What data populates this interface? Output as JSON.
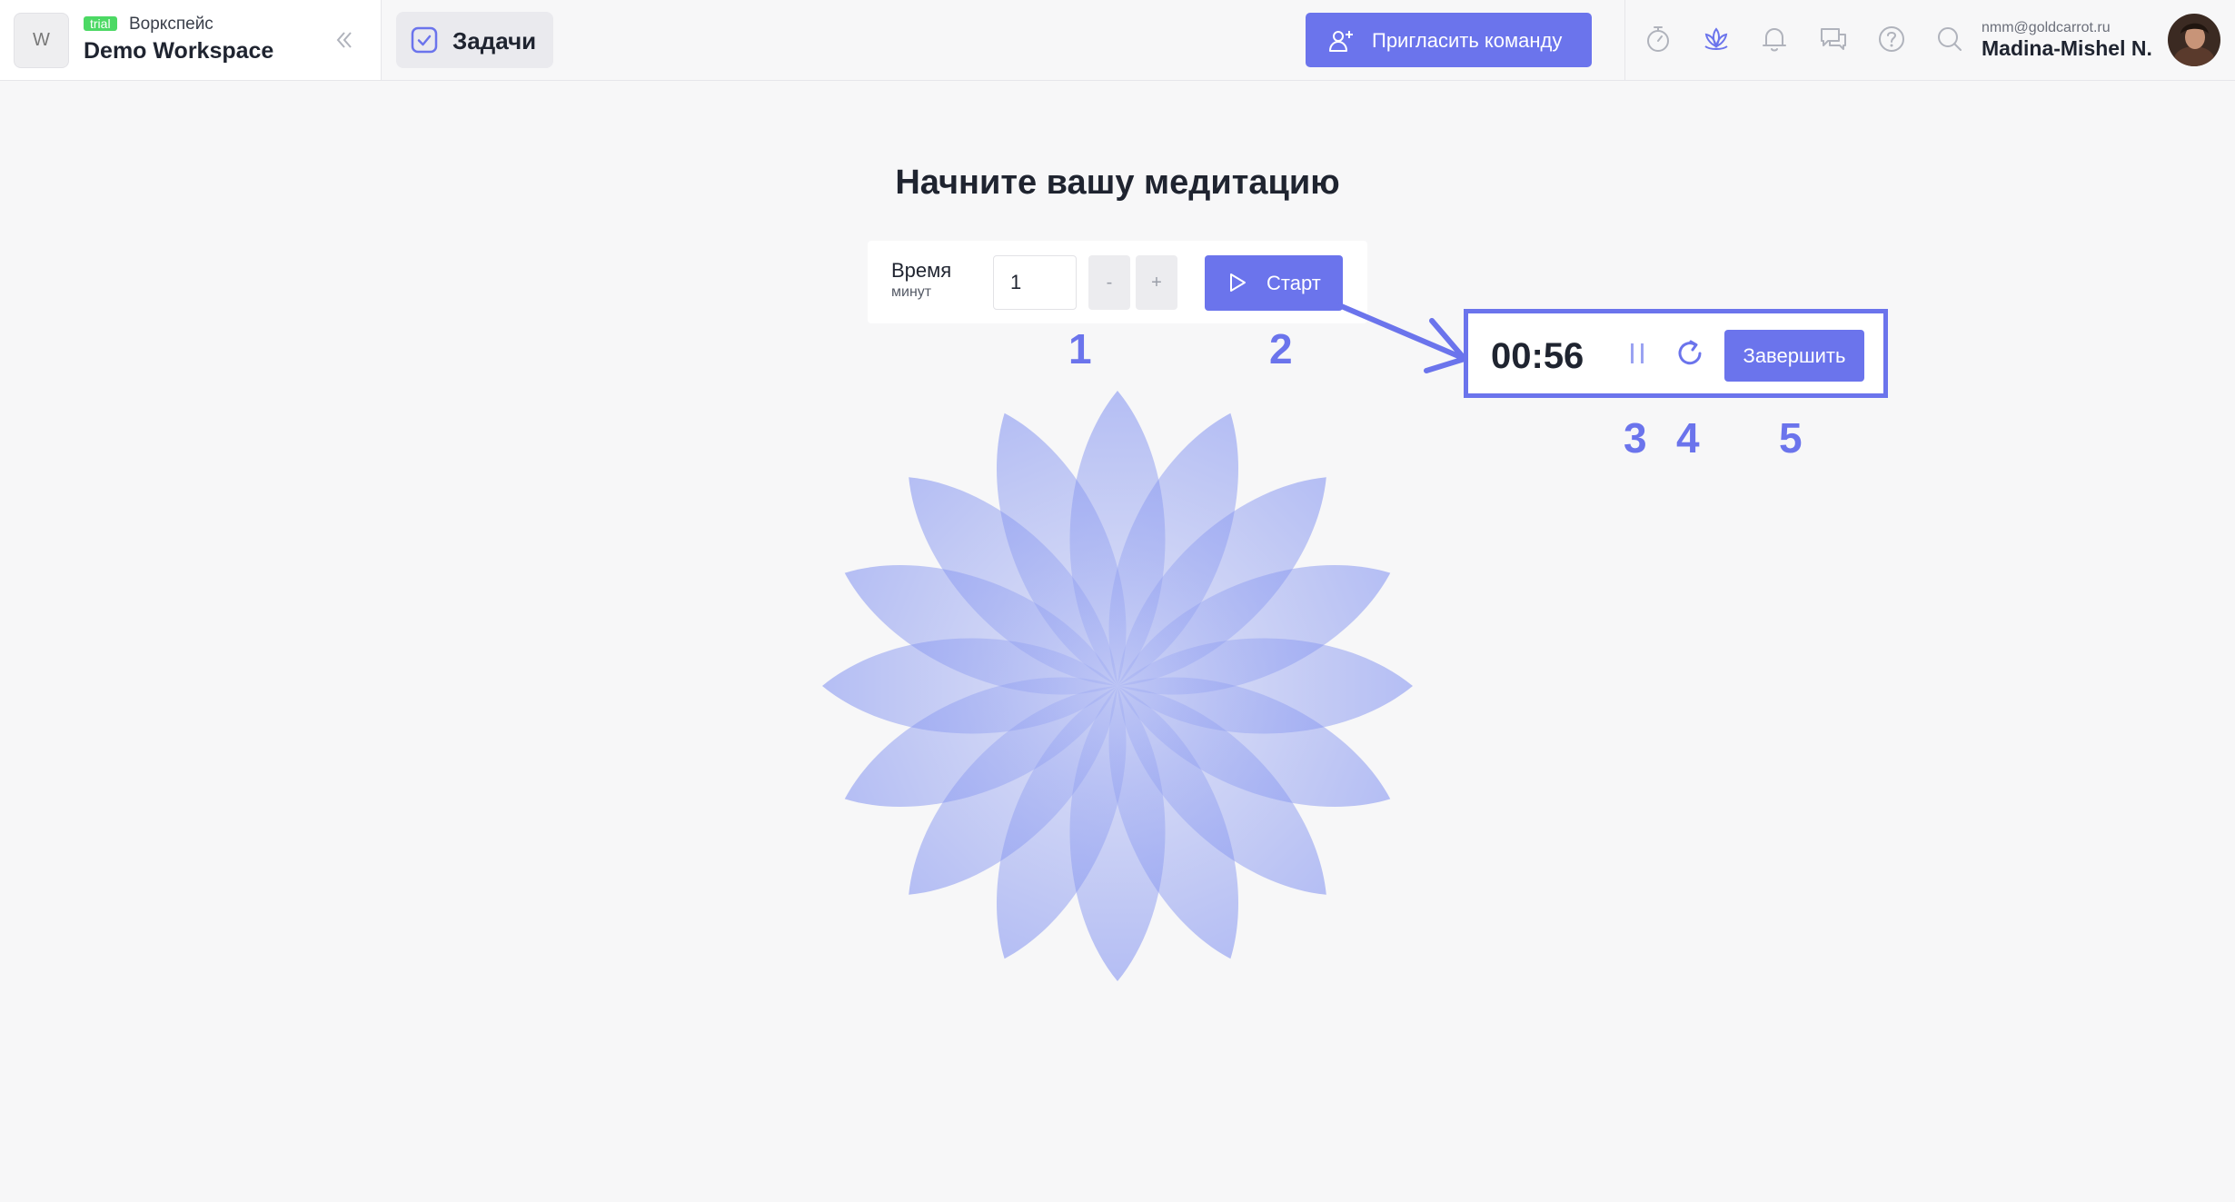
{
  "workspace": {
    "avatar_letter": "W",
    "badge": "trial",
    "subtitle": "Воркспейс",
    "name": "Demo Workspace"
  },
  "nav": {
    "tasks_label": "Задачи"
  },
  "header": {
    "invite_label": "Пригласить команду",
    "icons": [
      "timer-icon",
      "lotus-icon",
      "bell-icon",
      "chat-icon",
      "help-icon",
      "search-icon"
    ],
    "active_icon": "lotus-icon"
  },
  "user": {
    "email": "nmm@goldcarrot.ru",
    "name": "Madina-Mishel N."
  },
  "meditation": {
    "title": "Начните вашу медитацию",
    "time_label": "Время",
    "time_unit": "минут",
    "minutes_value": "1",
    "decrement_label": "-",
    "increment_label": "+",
    "start_label": "Старт"
  },
  "timer": {
    "value": "00:56",
    "finish_label": "Завершить"
  },
  "callouts": [
    "1",
    "2",
    "3",
    "4",
    "5"
  ],
  "colors": {
    "accent": "#6b74ec",
    "badge_green": "#4cd964",
    "petal": "#7e8ff0"
  }
}
